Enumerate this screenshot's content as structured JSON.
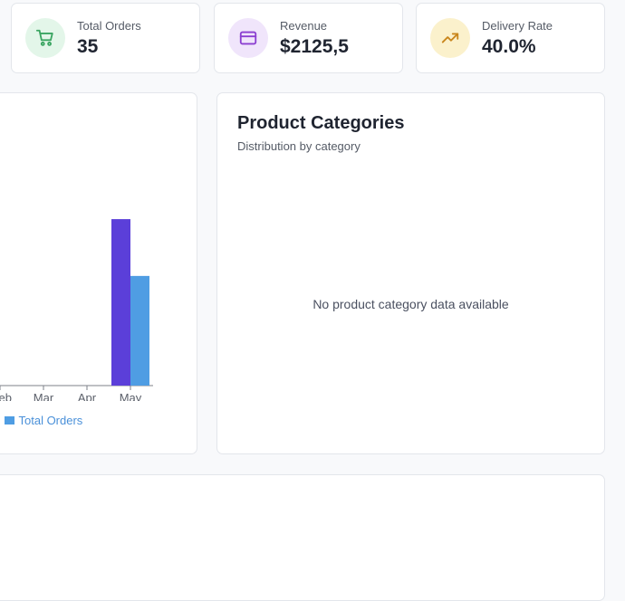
{
  "stats": {
    "orders": {
      "label": "Total Orders",
      "value": "35",
      "icon": "shopping-cart-icon",
      "bg": "#e3f6e9",
      "color": "#3aa561"
    },
    "revenue": {
      "label": "Revenue",
      "value": "$2125,5",
      "icon": "credit-card-icon",
      "bg": "#f0e5fb",
      "color": "#8b3fd1"
    },
    "delivery": {
      "label": "Delivery Rate",
      "value": "40.0%",
      "icon": "trending-up-icon",
      "bg": "#fbf1cc",
      "color": "#c9861c"
    }
  },
  "chart_data": {
    "type": "bar",
    "categories": [
      "Feb",
      "Mar",
      "Apr",
      "May"
    ],
    "visible_tick_labels": [
      "eb",
      "Mar",
      "Apr",
      "May"
    ],
    "series": [
      {
        "name": "",
        "color": "#5b3fd9",
        "values": [
          0,
          0,
          0,
          2125.5
        ]
      },
      {
        "name": "Total Orders",
        "color": "#4f9de3",
        "values": [
          0,
          0,
          0,
          1400
        ]
      }
    ],
    "legend": {
      "partial_label": "s",
      "series_label": "Total Orders",
      "placement": "bottom"
    },
    "ylim": [
      0,
      2300
    ]
  },
  "categories_card": {
    "title": "Product Categories",
    "subtitle": "Distribution by category",
    "empty_message": "No product category data available"
  },
  "bottom_card": {}
}
